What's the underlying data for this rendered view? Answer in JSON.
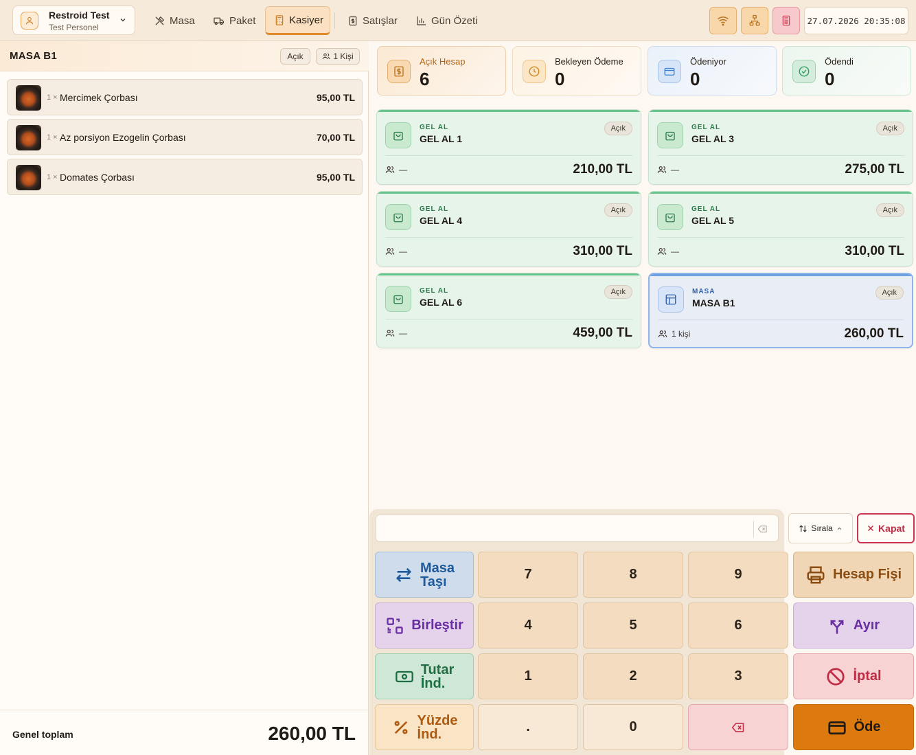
{
  "header": {
    "restaurant": "Restroid Test",
    "staff": "Test Personel",
    "nav": [
      {
        "label": "Masa",
        "icon": "utensils-icon"
      },
      {
        "label": "Paket",
        "icon": "truck-icon"
      },
      {
        "label": "Kasiyer",
        "icon": "calculator-icon",
        "active": true
      },
      {
        "label": "Satışlar",
        "icon": "receipt-icon"
      },
      {
        "label": "Gün Özeti",
        "icon": "bar-chart-icon"
      }
    ],
    "datetime": "27.07.2026 20:35:08"
  },
  "left": {
    "table_name": "MASA B1",
    "status": "Açık",
    "people": "1 Kişi",
    "items": [
      {
        "qty": "1 ×",
        "name": "Mercimek Çorbası",
        "price": "95,00 TL"
      },
      {
        "qty": "1 ×",
        "name": "Az porsiyon Ezogelin Çorbası",
        "price": "70,00 TL"
      },
      {
        "qty": "1 ×",
        "name": "Domates Çorbası",
        "price": "95,00 TL"
      }
    ],
    "total_label": "Genel toplam",
    "total_value": "260,00 TL"
  },
  "stats": [
    {
      "label": "Açık Hesap",
      "value": "6",
      "icon": "dollar-receipt-icon",
      "color": "#f0a848"
    },
    {
      "label": "Bekleyen Ödeme",
      "value": "0",
      "icon": "clock-icon",
      "color": "#f0a848"
    },
    {
      "label": "Ödeniyor",
      "value": "0",
      "icon": "credit-card-icon",
      "color": "#5a9be0"
    },
    {
      "label": "Ödendi",
      "value": "0",
      "icon": "check-circle-icon",
      "color": "#4fb07c"
    }
  ],
  "accounts": [
    {
      "type": "GEL AL",
      "name": "GEL AL 1",
      "status": "Açık",
      "people": "—",
      "amount": "210,00 TL"
    },
    {
      "type": "GEL AL",
      "name": "GEL AL 3",
      "status": "Açık",
      "people": "—",
      "amount": "275,00 TL"
    },
    {
      "type": "GEL AL",
      "name": "GEL AL 4",
      "status": "Açık",
      "people": "—",
      "amount": "310,00 TL"
    },
    {
      "type": "GEL AL",
      "name": "GEL AL 5",
      "status": "Açık",
      "people": "—",
      "amount": "310,00 TL"
    },
    {
      "type": "GEL AL",
      "name": "GEL AL 6",
      "status": "Açık",
      "people": "—",
      "amount": "459,00 TL"
    },
    {
      "type": "MASA",
      "name": "MASA B1",
      "status": "Açık",
      "people": "1 kişi",
      "amount": "260,00 TL",
      "selected": true
    }
  ],
  "keypad": {
    "input_value": "",
    "sort_label": "Sırala",
    "close_label": "Kapat",
    "digits": [
      "7",
      "8",
      "9",
      "4",
      "5",
      "6",
      "1",
      "2",
      "3",
      ".",
      "0"
    ],
    "actions": {
      "move": [
        "Masa",
        "Taşı"
      ],
      "merge": "Birleştir",
      "amount_discount": [
        "Tutar",
        "İnd."
      ],
      "percent_discount": [
        "Yüzde",
        "İnd."
      ],
      "receipt": "Hesap Fişi",
      "split": "Ayır",
      "cancel": "İptal",
      "pay": "Öde"
    }
  }
}
